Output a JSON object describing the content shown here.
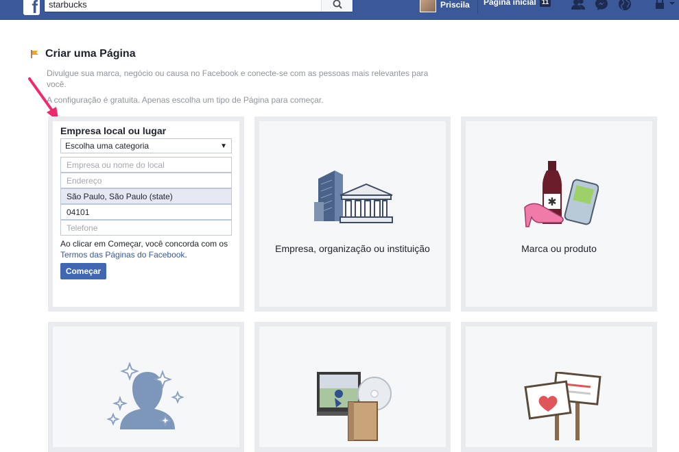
{
  "topbar": {
    "logo_letter": "f",
    "search_value": "starbucks",
    "user_name": "Priscila",
    "home_label": "Página inicial",
    "home_badge": "11",
    "icons": [
      "friend-requests-icon",
      "messenger-icon",
      "globe-icon",
      "privacy-lock-icon",
      "dropdown-arrow-icon"
    ]
  },
  "page": {
    "title": "Criar uma Página",
    "description": "Divulgue sua marca, negócio ou causa no Facebook e conecte-se com as pessoas mais relevantes para você.",
    "note": "A configuração é gratuita. Apenas escolha um tipo de Página para começar."
  },
  "form": {
    "title": "Empresa local ou lugar",
    "category_selected": "Escolha uma categoria",
    "business_placeholder": "Empresa ou nome do local",
    "address_placeholder": "Endereço",
    "city_value": "São Paulo, São Paulo (state)",
    "zip_value": "04101",
    "phone_placeholder": "Telefone",
    "terms_prefix": "Ao clicar em Começar, você concorda com os ",
    "terms_link": "Termos das Páginas do Facebook",
    "terms_suffix": ".",
    "start_label": "Começar"
  },
  "tiles": {
    "company": "Empresa, organização ou instituição",
    "brand": "Marca ou produto"
  },
  "colors": {
    "brand_blue": "#3b5998",
    "button_blue": "#4267b2",
    "arrow_pink": "#f0286e"
  }
}
